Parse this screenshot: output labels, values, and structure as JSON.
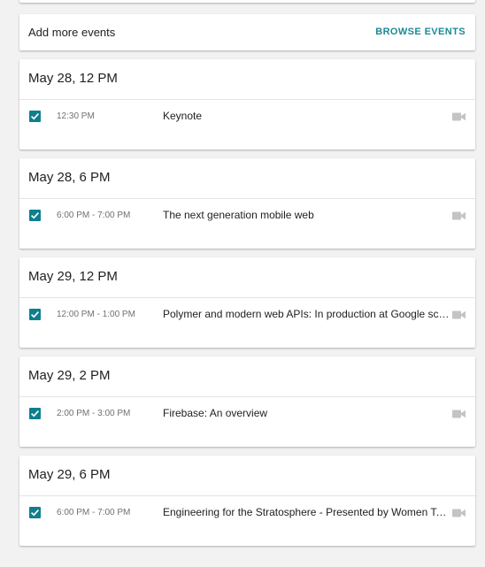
{
  "add_bar": {
    "label": "Add more events",
    "button": "BROWSE EVENTS"
  },
  "days": [
    {
      "header": "May 28, 12 PM",
      "time": "12:30 PM",
      "title": "Keynote",
      "checked": true,
      "icon": "video-icon"
    },
    {
      "header": "May 28, 6 PM",
      "time": "6:00 PM - 7:00 PM",
      "title": "The next generation mobile web",
      "checked": true,
      "icon": "video-icon"
    },
    {
      "header": "May 29, 12 PM",
      "time": "12:00 PM - 1:00 PM",
      "title": "Polymer and modern web APIs: In production at Google scale",
      "checked": true,
      "icon": "video-icon"
    },
    {
      "header": "May 29, 2 PM",
      "time": "2:00 PM - 3:00 PM",
      "title": "Firebase: An overview",
      "checked": true,
      "icon": "video-icon"
    },
    {
      "header": "May 29, 6 PM",
      "time": "6:00 PM - 7:00 PM",
      "title": "Engineering for the Stratosphere - Presented by Women Techmakers",
      "checked": true,
      "icon": "video-icon"
    }
  ],
  "colors": {
    "accent": "#1b8a96",
    "checkbox": "#0f7f8e",
    "background": "#f2f2f2",
    "icon": "#c4c4c4"
  }
}
